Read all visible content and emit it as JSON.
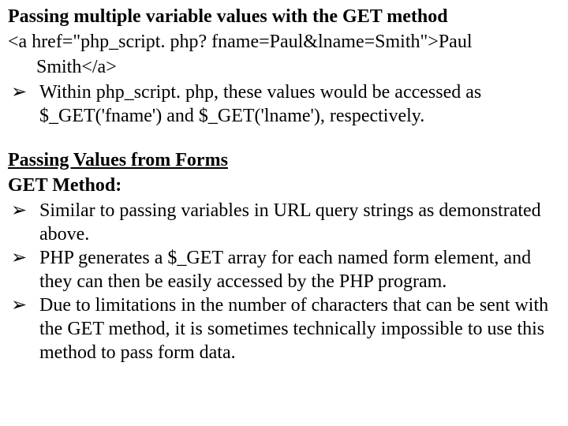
{
  "section1": {
    "title": "Passing multiple variable values with the GET method",
    "code_line1": "<a href=\"php_script. php? fname=Paul&lname=Smith\">Paul",
    "code_line2": "Smith</a>",
    "bullet1": "Within php_script. php, these values would be accessed as $_GET('fname') and $_GET('lname'), respectively."
  },
  "section2": {
    "title": "Passing Values from Forms",
    "subtitle": "GET Method:",
    "bullet1": "Similar to passing variables in URL query strings as demonstrated above.",
    "bullet2": "PHP generates a $_GET array for each named form element, and they can then be easily accessed by the PHP program.",
    "bullet3": "Due to limitations in the number of characters that can be sent with the GET method, it is sometimes technically impossible to use this method to pass form data."
  },
  "bullet_glyph": "➢"
}
